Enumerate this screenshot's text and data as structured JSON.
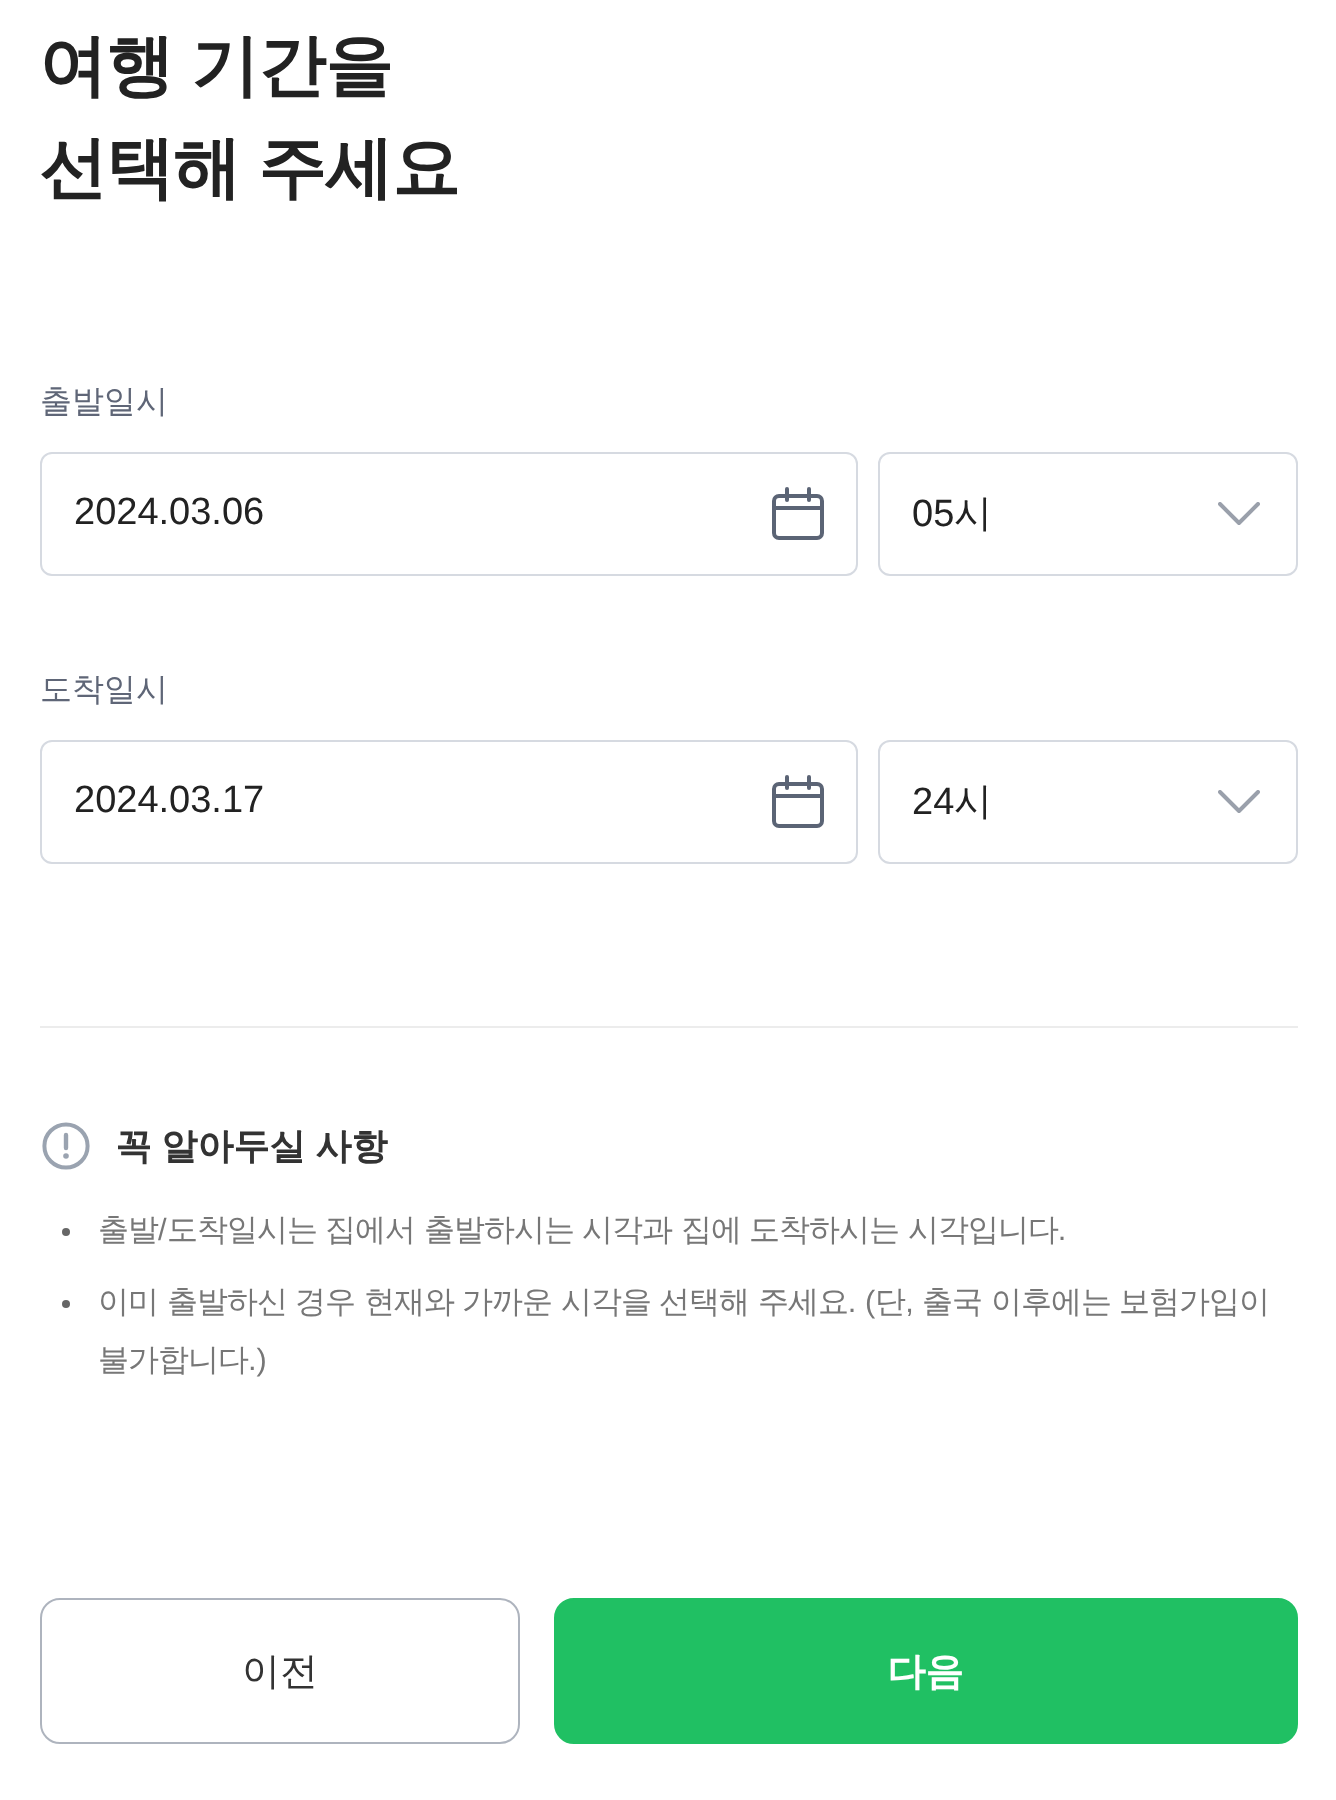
{
  "title_lines": [
    "여행 기간을",
    "선택해 주세요"
  ],
  "schedule": [
    {
      "label": "출발일시",
      "date": "2024.03.06",
      "hour": "05시"
    },
    {
      "label": "도착일시",
      "date": "2024.03.17",
      "hour": "24시"
    }
  ],
  "notice": {
    "heading": "꼭 알아두실 사항",
    "items": [
      "출발/도착일시는 집에서 출발하시는 시각과 집에 도착하시는 시각입니다.",
      "이미 출발하신 경우 현재와 가까운 시각을 선택해 주세요. (단, 출국 이후에는 보험가입이 불가합니다.)"
    ]
  },
  "buttons": [
    {
      "label": "이전",
      "kind": "secondary"
    },
    {
      "label": "다음",
      "kind": "primary"
    }
  ]
}
